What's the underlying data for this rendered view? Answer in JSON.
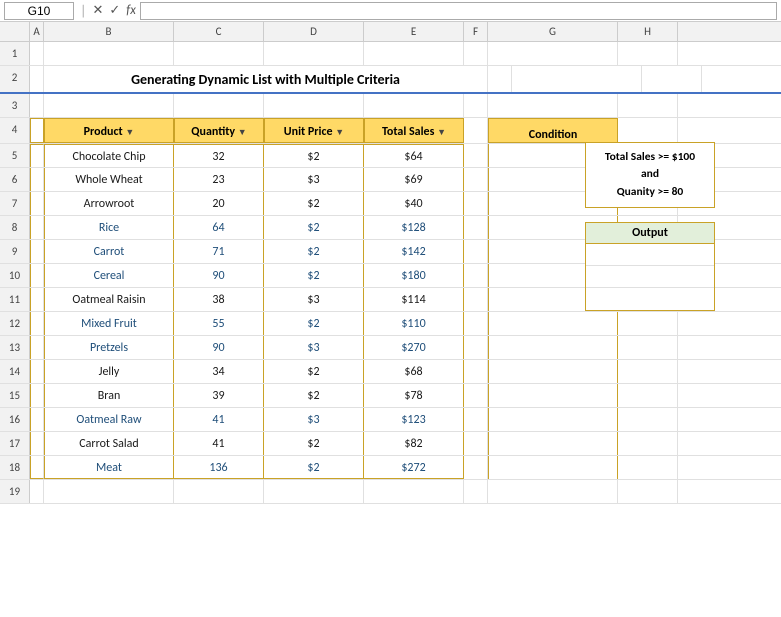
{
  "namebox": {
    "value": "G10"
  },
  "formulabar": {
    "value": ""
  },
  "cols": [
    "A",
    "B",
    "C",
    "D",
    "E",
    "F",
    "G",
    "H"
  ],
  "title": "Generating Dynamic List with Multiple Criteria",
  "table": {
    "headers": [
      "Product",
      "Quantity",
      "Unit Price",
      "Total Sales"
    ],
    "rows": [
      {
        "product": "Chocolate Chip",
        "quantity": "32",
        "unit_price": "$2",
        "total_sales": "$64",
        "highlight": false
      },
      {
        "product": "Whole Wheat",
        "quantity": "23",
        "unit_price": "$3",
        "total_sales": "$69",
        "highlight": false
      },
      {
        "product": "Arrowroot",
        "quantity": "20",
        "unit_price": "$2",
        "total_sales": "$40",
        "highlight": false
      },
      {
        "product": "Rice",
        "quantity": "64",
        "unit_price": "$2",
        "total_sales": "$128",
        "highlight": true
      },
      {
        "product": "Carrot",
        "quantity": "71",
        "unit_price": "$2",
        "total_sales": "$142",
        "highlight": true
      },
      {
        "product": "Cereal",
        "quantity": "90",
        "unit_price": "$2",
        "total_sales": "$180",
        "highlight": true
      },
      {
        "product": "Oatmeal Raisin",
        "quantity": "38",
        "unit_price": "$3",
        "total_sales": "$114",
        "highlight": false
      },
      {
        "product": "Mixed Fruit",
        "quantity": "55",
        "unit_price": "$2",
        "total_sales": "$110",
        "highlight": true
      },
      {
        "product": "Pretzels",
        "quantity": "90",
        "unit_price": "$3",
        "total_sales": "$270",
        "highlight": true
      },
      {
        "product": "Jelly",
        "quantity": "34",
        "unit_price": "$2",
        "total_sales": "$68",
        "highlight": false
      },
      {
        "product": "Bran",
        "quantity": "39",
        "unit_price": "$2",
        "total_sales": "$78",
        "highlight": false
      },
      {
        "product": "Oatmeal Raw",
        "quantity": "41",
        "unit_price": "$3",
        "total_sales": "$123",
        "highlight": true
      },
      {
        "product": "Carrot Salad",
        "quantity": "41",
        "unit_price": "$2",
        "total_sales": "$82",
        "highlight": false
      },
      {
        "product": "Meat",
        "quantity": "136",
        "unit_price": "$2",
        "total_sales": "$272",
        "highlight": true
      }
    ]
  },
  "condition": {
    "header": "Condition",
    "text": "Total Sales >= $100\nand\nQuanity >= 80"
  },
  "output": {
    "header": "Output",
    "rows": [
      "",
      "",
      ""
    ]
  },
  "row_numbers": [
    "1",
    "2",
    "3",
    "4",
    "5",
    "6",
    "7",
    "8",
    "9",
    "10",
    "11",
    "12",
    "13",
    "14",
    "15",
    "16",
    "17",
    "18",
    "19"
  ]
}
